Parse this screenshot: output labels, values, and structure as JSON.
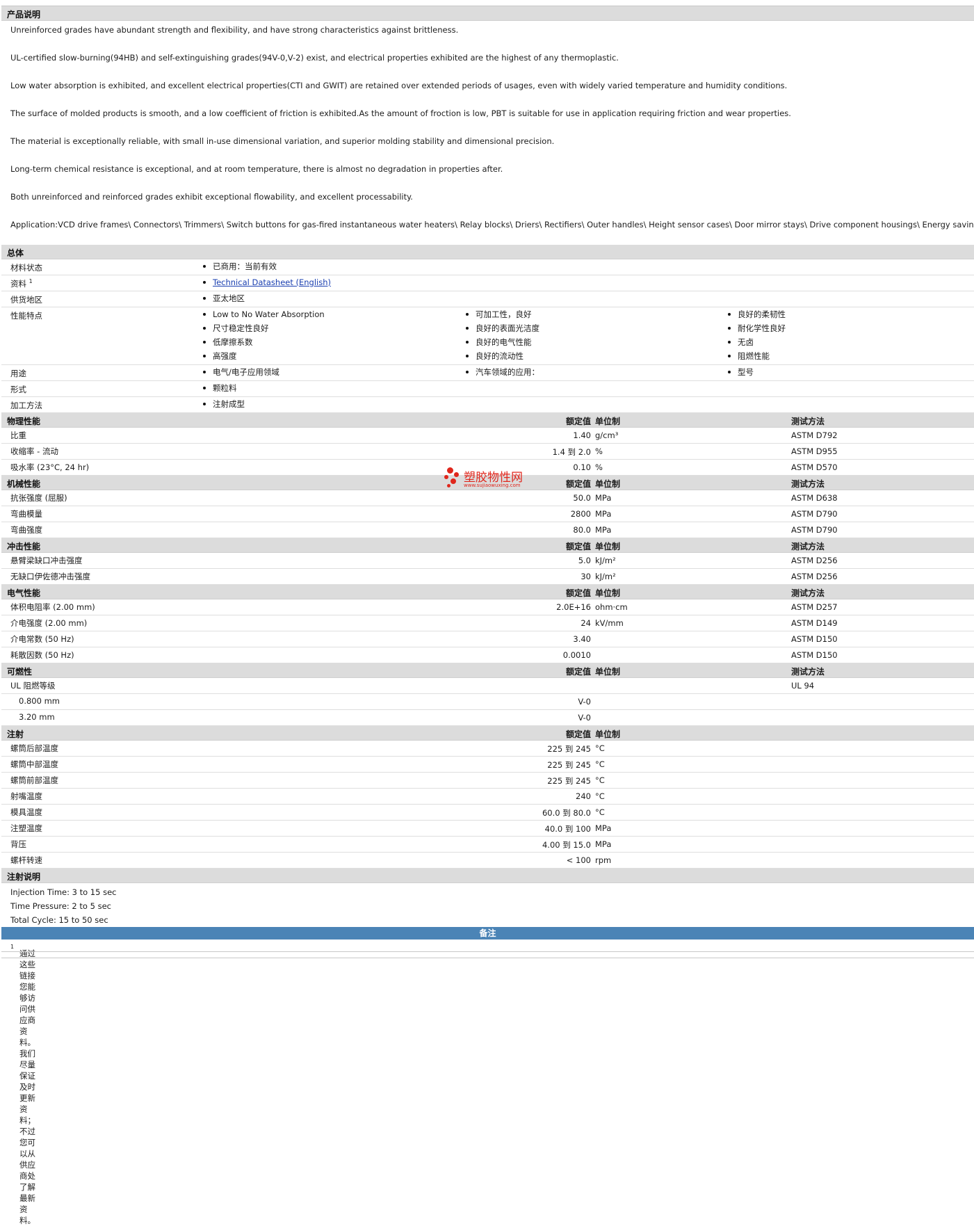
{
  "desc_section": {
    "title": "产品说明",
    "paragraphs": [
      "Unreinforced grades have abundant strength and flexibility, and have strong characteristics against brittleness.",
      "UL-certified slow-burning(94HB) and self-extinguishing grades(94V-0,V-2) exist, and electrical properties exhibited are the highest of any thermoplastic.",
      "Low water absorption is exhibited, and excellent electrical properties(CTI and GWIT) are retained over extended periods of usages, even with widely varied temperature and humidity conditions.",
      "The surface of molded products is smooth, and a low coefficient of friction is exhibited.As the amount of froction is low, PBT is suitable for use in application requiring friction and wear properties.",
      "The material is exceptionally reliable, with small in-use dimensional variation, and superior molding stability and dimensional precision.",
      "Long-term chemical resistance is exceptional, and at room temperature, there is almost no degradation in properties after.",
      "Both unreinforced and reinforced grades exhibit exceptional flowability, and excellent processability.",
      "Application:VCD drive frames\\ Connectors\\ Trimmers\\ Switch buttons for gas-fired instantaneous water heaters\\ Relay blocks\\ Driers\\ Rectifiers\\ Outer handles\\ Height sensor cases\\ Door mirror stays\\ Drive component housings\\ Energy saving lamp."
    ]
  },
  "general": {
    "title": "总体",
    "rows": [
      {
        "label": "材料状态",
        "sup": "",
        "columns": [
          [
            "已商用：当前有效"
          ]
        ]
      },
      {
        "label": "资料",
        "sup": "1",
        "link": "Technical Datasheet (English)"
      },
      {
        "label": "供货地区",
        "sup": "",
        "columns": [
          [
            "亚太地区"
          ]
        ]
      },
      {
        "label": "性能特点",
        "sup": "",
        "columns": [
          [
            "Low to No Water Absorption",
            "尺寸稳定性良好",
            "低摩擦系数",
            "高强度"
          ],
          [
            "可加工性，良好",
            "良好的表面光洁度",
            "良好的电气性能",
            "良好的流动性"
          ],
          [
            "良好的柔韧性",
            "耐化学性良好",
            "无卤",
            "阻燃性能"
          ]
        ]
      },
      {
        "label": "用途",
        "sup": "",
        "columns": [
          [
            "电气/电子应用领域"
          ],
          [
            "汽车领域的应用："
          ],
          [
            "型号"
          ]
        ]
      },
      {
        "label": "形式",
        "sup": "",
        "columns": [
          [
            "颗粒料"
          ]
        ]
      },
      {
        "label": "加工方法",
        "sup": "",
        "columns": [
          [
            "注射成型"
          ]
        ]
      }
    ]
  },
  "headers": {
    "nominal": "额定值",
    "unit": "单位制",
    "test": "测试方法"
  },
  "property_sections": [
    {
      "title": "物理性能",
      "test_header": true,
      "rows": [
        {
          "label": "比重",
          "value": "1.40",
          "unit": "g/cm³",
          "test": "ASTM D792"
        },
        {
          "label": "收缩率  - 流动",
          "value": "1.4 到  2.0",
          "unit": "%",
          "test": "ASTM D955"
        },
        {
          "label": "吸水率  (23°C, 24 hr)",
          "value": "0.10",
          "unit": "%",
          "test": "ASTM D570"
        }
      ]
    },
    {
      "title": "机械性能",
      "test_header": true,
      "rows": [
        {
          "label": "抗张强度  (屈服)",
          "value": "50.0",
          "unit": "MPa",
          "test": "ASTM D638"
        },
        {
          "label": "弯曲模量",
          "value": "2800",
          "unit": "MPa",
          "test": "ASTM D790"
        },
        {
          "label": "弯曲强度",
          "value": "80.0",
          "unit": "MPa",
          "test": "ASTM D790"
        }
      ]
    },
    {
      "title": "冲击性能",
      "test_header": true,
      "rows": [
        {
          "label": "悬臂梁缺口冲击强度",
          "value": "5.0",
          "unit": "kJ/m²",
          "test": "ASTM D256"
        },
        {
          "label": "无缺口伊佐德冲击强度",
          "value": "30",
          "unit": "kJ/m²",
          "test": "ASTM D256"
        }
      ]
    },
    {
      "title": "电气性能",
      "test_header": true,
      "rows": [
        {
          "label": "体积电阻率  (2.00 mm)",
          "value": "2.0E+16",
          "unit": "ohm·cm",
          "test": "ASTM D257"
        },
        {
          "label": "介电强度  (2.00 mm)",
          "value": "24",
          "unit": "kV/mm",
          "test": "ASTM D149"
        },
        {
          "label": "介电常数  (50 Hz)",
          "value": "3.40",
          "unit": "",
          "test": "ASTM D150"
        },
        {
          "label": "耗散因数  (50 Hz)",
          "value": "0.0010",
          "unit": "",
          "test": "ASTM D150"
        }
      ]
    },
    {
      "title": "可燃性",
      "test_header": true,
      "rows": [
        {
          "label": "UL 阻燃等级",
          "value": "",
          "unit": "",
          "test": "UL 94"
        },
        {
          "label": "0.800 mm",
          "value": "V-0",
          "unit": "",
          "test": "",
          "indent": true
        },
        {
          "label": "3.20 mm",
          "value": "V-0",
          "unit": "",
          "test": "",
          "indent": true
        }
      ]
    },
    {
      "title": "注射",
      "test_header": false,
      "rows": [
        {
          "label": "螺筒后部温度",
          "value": "225 到  245",
          "unit": "°C",
          "test": ""
        },
        {
          "label": "螺筒中部温度",
          "value": "225 到  245",
          "unit": "°C",
          "test": ""
        },
        {
          "label": "螺筒前部温度",
          "value": "225 到  245",
          "unit": "°C",
          "test": ""
        },
        {
          "label": "射嘴温度",
          "value": "240",
          "unit": "°C",
          "test": ""
        },
        {
          "label": "模具温度",
          "value": "60.0 到  80.0",
          "unit": "°C",
          "test": ""
        },
        {
          "label": "注塑温度",
          "value": "40.0 到  100",
          "unit": "MPa",
          "test": ""
        },
        {
          "label": "背压",
          "value": "4.00 到  15.0",
          "unit": "MPa",
          "test": ""
        },
        {
          "label": "螺杆转速",
          "value": "< 100",
          "unit": "rpm",
          "test": ""
        }
      ]
    }
  ],
  "injection_notes": {
    "title": "注射说明",
    "lines": [
      "Injection Time: 3 to 15 sec",
      "Time Pressure: 2 to 5 sec",
      "Total Cycle: 15 to 50 sec"
    ]
  },
  "remarks": {
    "title": "备注",
    "footnote_mark": "1",
    "footnote": "通过这些链接您能够访问供应商资料。我们尽量保证及时更新资料；不过您可以从供应商处了解最新资料。"
  },
  "watermark": {
    "cn": "塑胶物性网",
    "en": "www.sujiaowuxing.com",
    "color": "#e0261c"
  },
  "colors": {
    "section_bg": "#dcdcdc",
    "band_bg": "#4b84b6",
    "link": "#1a3fb0"
  }
}
